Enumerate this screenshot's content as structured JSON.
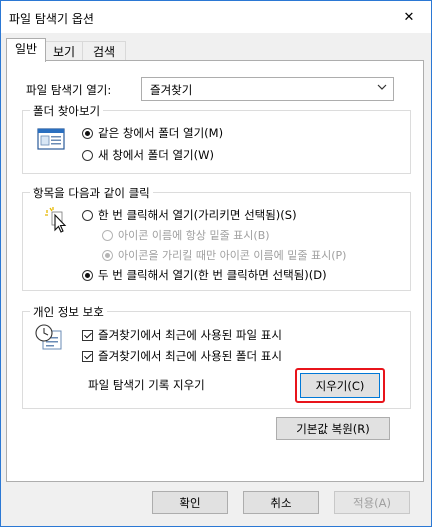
{
  "dialog": {
    "title": "파일 탐색기 옵션",
    "close_glyph": "✕"
  },
  "tabs": [
    {
      "label": "일반",
      "active": true
    },
    {
      "label": "보기",
      "active": false
    },
    {
      "label": "검색",
      "active": false
    }
  ],
  "general": {
    "open_label": "파일 탐색기 열기:",
    "open_value": "즐겨찾기",
    "browse": {
      "legend": "폴더 찾아보기",
      "options": [
        {
          "label": "같은 창에서 폴더 열기(M)",
          "checked": true
        },
        {
          "label": "새 창에서 폴더 열기(W)",
          "checked": false
        }
      ]
    },
    "click": {
      "legend": "항목을 다음과 같이 클릭",
      "single": {
        "label": "한 번 클릭해서 열기(가리키면 선택됨)(S)",
        "checked": false
      },
      "sub_options": [
        {
          "label": "아이콘 이름에 항상 밑줄 표시(B)",
          "checked": false,
          "disabled": true
        },
        {
          "label": "아이콘을 가리킬 때만 아이콘 이름에 밑줄 표시(P)",
          "checked": true,
          "disabled": true
        }
      ],
      "double": {
        "label": "두 번 클릭해서 열기(한 번 클릭하면 선택됨)(D)",
        "checked": true
      }
    },
    "privacy": {
      "legend": "개인 정보 보호",
      "checks": [
        {
          "label": "즐겨찾기에서 최근에 사용된 파일 표시",
          "checked": true
        },
        {
          "label": "즐겨찾기에서 최근에 사용된 폴더 표시",
          "checked": true
        }
      ],
      "history_label": "파일 탐색기 기록 지우기",
      "clear_button": "지우기(C)"
    },
    "restore_button": "기본값 복원(R)"
  },
  "footer": {
    "ok": "확인",
    "cancel": "취소",
    "apply": "적용(A)"
  },
  "colors": {
    "highlight_box": "#e8141b",
    "focus_border": "#0078d7",
    "window_border": "#2b78d4"
  }
}
